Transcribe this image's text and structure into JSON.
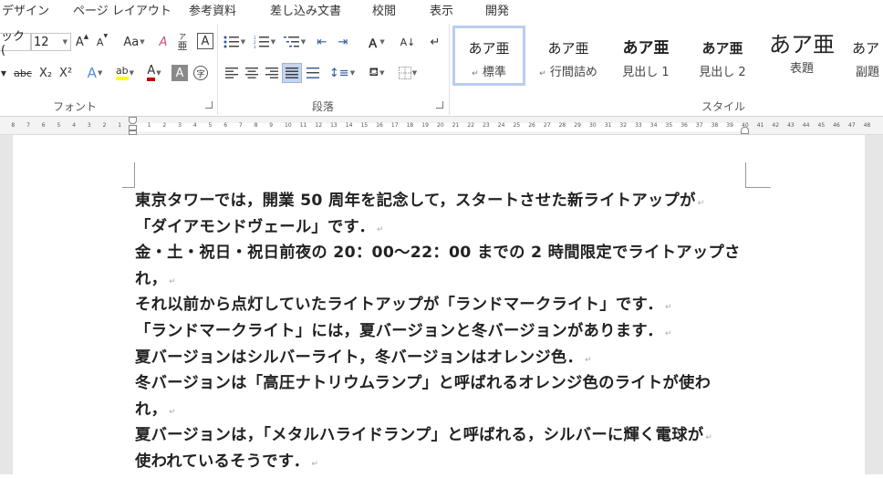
{
  "tabs": [
    "デザイン",
    "ページ レイアウト",
    "参考資料",
    "差し込み文書",
    "校閲",
    "表示",
    "開発"
  ],
  "font_group": {
    "font_name": "ック (",
    "font_size": "12",
    "grow": "A",
    "shrink": "A",
    "case": "Aa",
    "clear": "A",
    "ruby_top": "ア",
    "ruby_bottom": "亜",
    "border_char": "A",
    "strike": "abc",
    "sub": "X₂",
    "sup": "X²",
    "effects": "A",
    "highlight": "ab",
    "font_color": "A",
    "shade": "A",
    "enclose": "字",
    "label": "フォント"
  },
  "paragraph_group": {
    "label": "段落"
  },
  "styles_group": {
    "label": "スタイル",
    "items": [
      {
        "preview": "あア亜",
        "name": "標準",
        "mark": "↵"
      },
      {
        "preview": "あア亜",
        "name": "行間詰め",
        "mark": "↵"
      },
      {
        "preview": "あア亜",
        "name": "見出し 1",
        "mark": ""
      },
      {
        "preview": "あア亜",
        "name": "見出し 2",
        "mark": ""
      },
      {
        "preview": "あア亜",
        "name": "表題",
        "mark": ""
      },
      {
        "preview": "あア",
        "name": "副題",
        "mark": ""
      }
    ]
  },
  "ruler": {
    "left_labels": [
      "8",
      "7",
      "6",
      "5",
      "4",
      "3",
      "2",
      "1"
    ],
    "right_labels": [
      "1",
      "2",
      "3",
      "4",
      "5",
      "6",
      "7",
      "8",
      "9",
      "10",
      "11",
      "12",
      "13",
      "14",
      "15",
      "16",
      "17",
      "18",
      "19",
      "20",
      "21",
      "22",
      "23",
      "24",
      "25",
      "26",
      "27",
      "28",
      "29",
      "30",
      "31",
      "32",
      "33",
      "34",
      "35",
      "36",
      "37",
      "38",
      "39",
      "40",
      "41",
      "42",
      "43",
      "44",
      "45",
      "46",
      "47",
      "48"
    ]
  },
  "document": {
    "paragraph_mark": "↵",
    "lines": [
      {
        "text": "東京タワーでは，開業 50 周年を記念して，スタートさせた新ライトアップが",
        "mark": true
      },
      {
        "text": "「ダイアモンドヴェール」です．",
        "mark": true
      },
      {
        "text": "金・土・祝日・祝日前夜の 20：00〜22：00 までの 2 時間限定でライトアップさ",
        "mark": false
      },
      {
        "text": "れ，",
        "mark": true
      },
      {
        "text": "それ以前から点灯していたライトアップが「ランドマークライト」です．",
        "mark": true
      },
      {
        "text": "「ランドマークライト」には，夏バージョンと冬バージョンがあります．",
        "mark": true
      },
      {
        "text": "夏バージョンはシルバーライト，冬バージョンはオレンジ色．",
        "mark": true
      },
      {
        "text": "冬バージョンは「高圧ナトリウムランプ」と呼ばれるオレンジ色のライトが使わ",
        "mark": false
      },
      {
        "text": "れ，",
        "mark": true
      },
      {
        "text": "夏バージョンは，「メタルハライドランプ」と呼ばれる，シルバーに輝く電球が",
        "mark": true
      },
      {
        "text": "使われているそうです．",
        "mark": true
      }
    ]
  },
  "colors": {
    "highlight": "#ffff00",
    "font_color": "#c00000",
    "accent": "#b9cdf0"
  }
}
